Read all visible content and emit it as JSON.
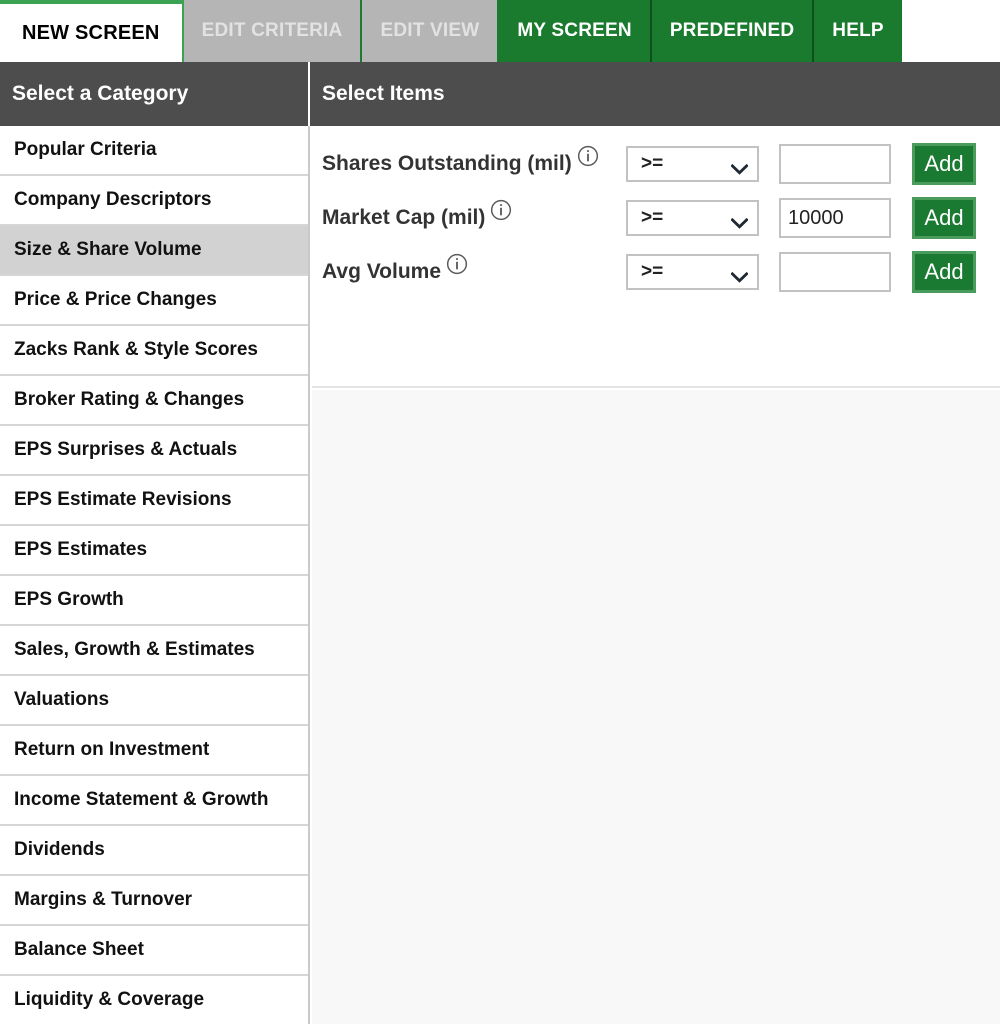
{
  "tabs": [
    {
      "label": "NEW SCREEN",
      "state": "active"
    },
    {
      "label": "EDIT CRITERIA",
      "state": "disabled"
    },
    {
      "label": "EDIT VIEW",
      "state": "disabled"
    },
    {
      "label": "MY SCREEN",
      "state": "green"
    },
    {
      "label": "PREDEFINED",
      "state": "green"
    },
    {
      "label": "HELP",
      "state": "green"
    }
  ],
  "panels": {
    "category_header": "Select a Category",
    "items_header": "Select Items"
  },
  "sidebar": {
    "selected_index": 2,
    "items": [
      {
        "label": "Popular Criteria"
      },
      {
        "label": "Company Descriptors"
      },
      {
        "label": "Size & Share Volume"
      },
      {
        "label": "Price & Price Changes"
      },
      {
        "label": "Zacks Rank & Style Scores"
      },
      {
        "label": "Broker Rating & Changes"
      },
      {
        "label": "EPS Surprises & Actuals"
      },
      {
        "label": "EPS Estimate Revisions"
      },
      {
        "label": "EPS Estimates"
      },
      {
        "label": "EPS Growth"
      },
      {
        "label": "Sales, Growth & Estimates"
      },
      {
        "label": "Valuations"
      },
      {
        "label": "Return on Investment"
      },
      {
        "label": "Income Statement & Growth"
      },
      {
        "label": "Dividends"
      },
      {
        "label": "Margins & Turnover"
      },
      {
        "label": "Balance Sheet"
      },
      {
        "label": "Liquidity & Coverage"
      }
    ]
  },
  "criteria": {
    "add_label": "Add",
    "value_placeholder": "",
    "rows": [
      {
        "label": "Shares Outstanding (mil)",
        "operator": ">=",
        "value": "",
        "info_icon": "info-circle-icon"
      },
      {
        "label": "Market Cap (mil)",
        "operator": ">=",
        "value": "10000",
        "info_icon": "info-circle-icon"
      },
      {
        "label": "Avg Volume",
        "operator": ">=",
        "value": "",
        "info_icon": "info-circle-icon"
      }
    ]
  },
  "colors": {
    "brand_green": "#1a7a2e",
    "button_green": "#1a7a32",
    "header_gray": "#4d4d4d",
    "selected_gray": "#d2d2d2",
    "disabled_tab": "#b5b5b5"
  }
}
